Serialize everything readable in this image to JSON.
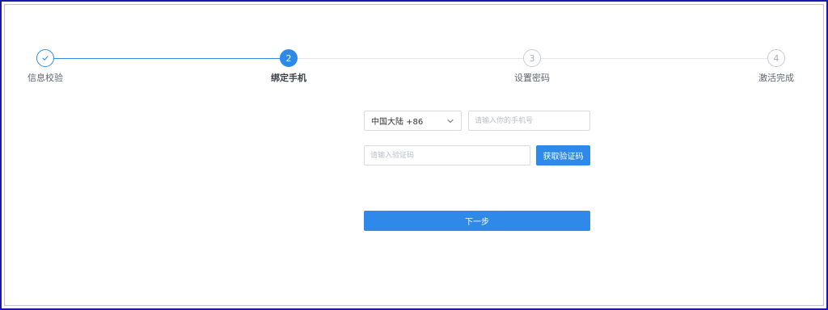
{
  "stepper": {
    "steps": [
      {
        "label": "信息校验",
        "number": "",
        "state": "done"
      },
      {
        "label": "绑定手机",
        "number": "2",
        "state": "current"
      },
      {
        "label": "设置密码",
        "number": "3",
        "state": "todo"
      },
      {
        "label": "激活完成",
        "number": "4",
        "state": "todo"
      }
    ]
  },
  "form": {
    "country_select": "中国大陆 +86",
    "phone_placeholder": "请输入你的手机号",
    "code_placeholder": "请输入验证码",
    "get_code_label": "获取验证码",
    "next_label": "下一步"
  },
  "colors": {
    "accent": "#2f89e8",
    "frame_border": "#1a1aa6"
  }
}
